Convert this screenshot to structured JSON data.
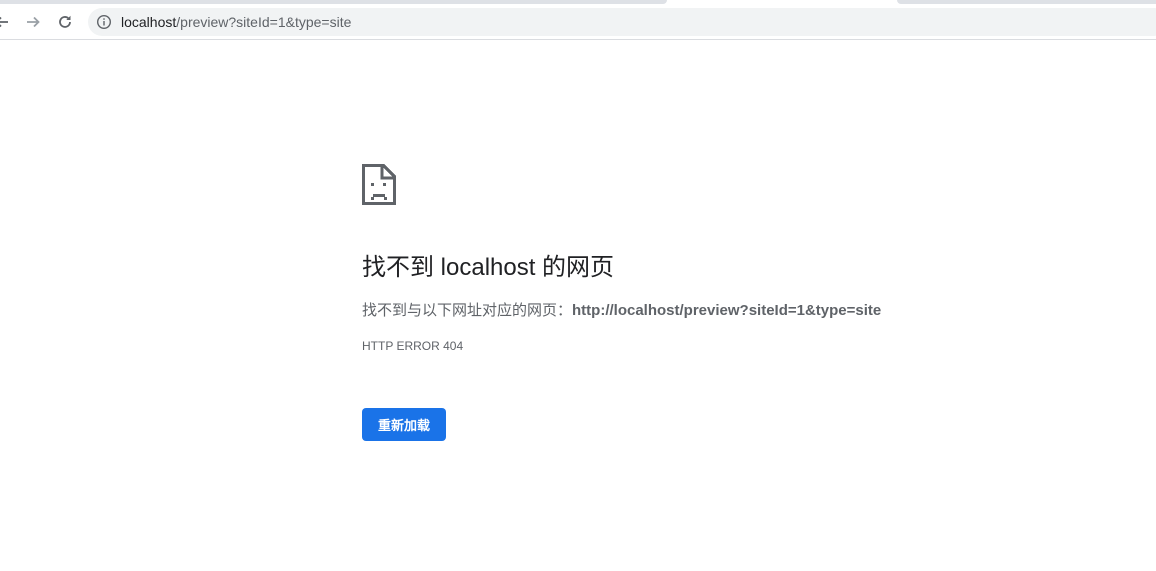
{
  "browser": {
    "url_host": "localhost",
    "url_path": "/preview?siteId=1&type=site"
  },
  "error_page": {
    "icon": "sad-page-icon",
    "heading": "找不到 localhost 的网页",
    "description_prefix": "找不到与以下网址对应的网页：",
    "description_url": "http://localhost/preview?siteId=1&type=site",
    "error_code": "HTTP ERROR 404",
    "reload_label": "重新加载"
  },
  "colors": {
    "accent": "#1a73e8",
    "text_primary": "#202124",
    "text_secondary": "#5f6368",
    "omnibox_bg": "#f1f3f4"
  }
}
